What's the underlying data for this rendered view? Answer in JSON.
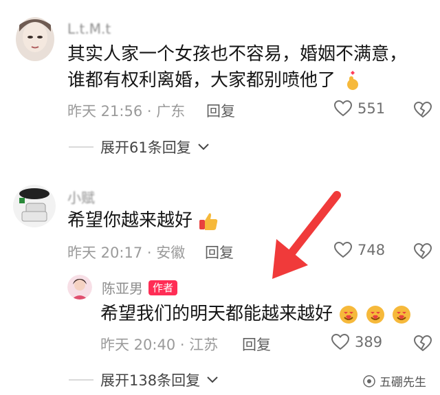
{
  "comments": [
    {
      "username": "L.t.M.t",
      "line1": "其实人家一个女孩也不容易，婚姻不满意，",
      "line2": "谁都有权利离婚，大家都别喷他了",
      "meta": "昨天 21:56 · 广东",
      "reply": "回复",
      "likes": "551",
      "expand": "展开61条回复"
    },
    {
      "username": "小赋",
      "line1": "希望你越来越好",
      "meta": "昨天 20:17 · 安徽",
      "reply": "回复",
      "likes": "748"
    }
  ],
  "reply": {
    "username": "陈亚男",
    "badge": "作者",
    "line1": "希望我们的明天都能越来越好",
    "meta": "昨天 20:40 · 江苏",
    "reply": "回复",
    "likes": "389",
    "expand": "展开138条回复"
  },
  "watermark": "五硼先生",
  "colors": {
    "arrow": "#f03a3a",
    "badge": "#ff2d55"
  }
}
